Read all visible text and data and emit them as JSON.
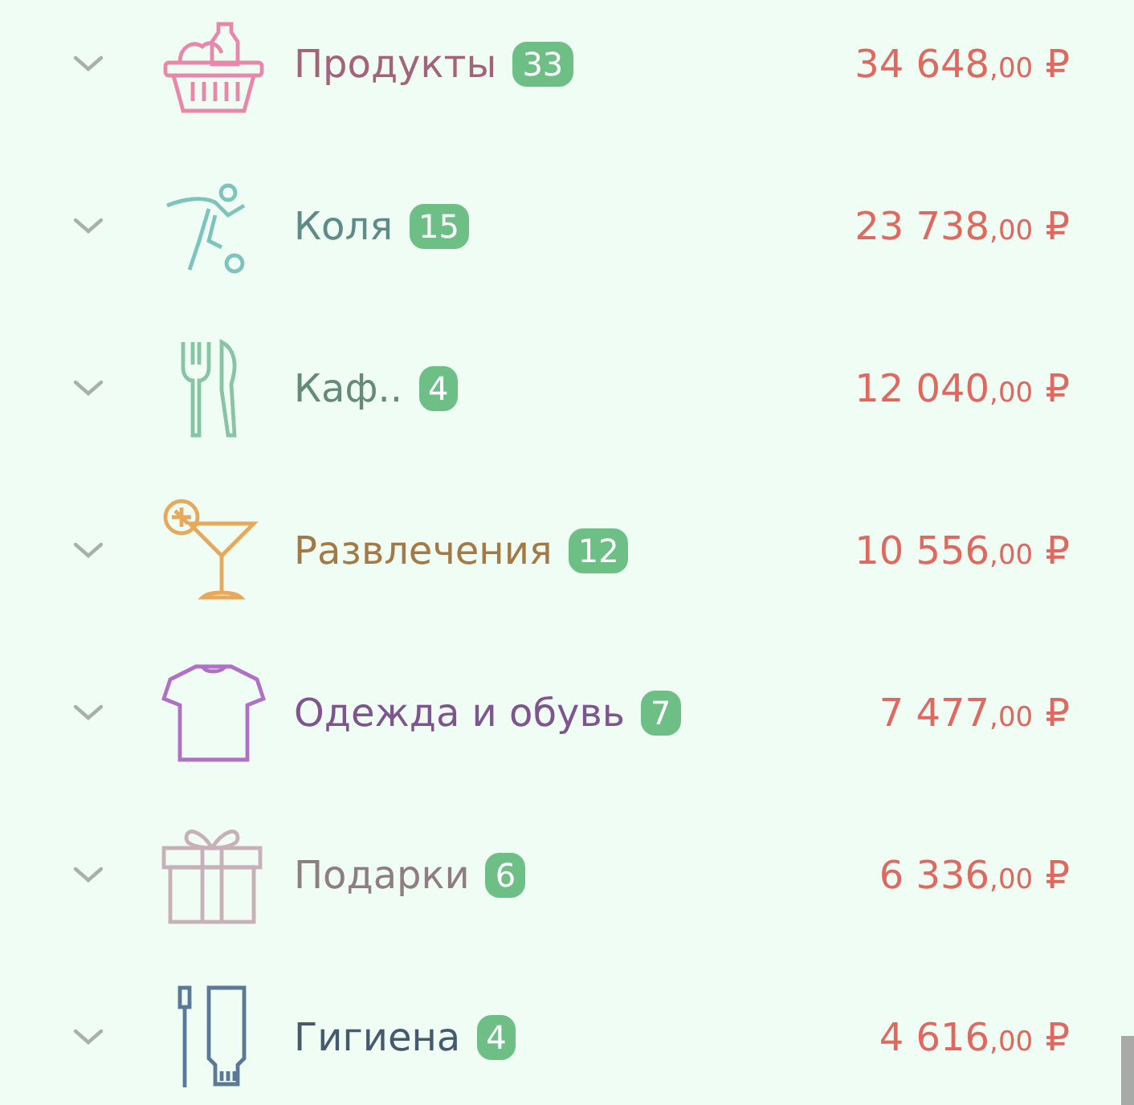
{
  "categories": [
    {
      "kind": "basket",
      "name": "Продукты",
      "count": "33",
      "color": "#e887a9",
      "amount": "34 648",
      "cents": ",00",
      "currency": "₽",
      "expanded": false
    },
    {
      "kind": "football",
      "name": "Коля",
      "count": "15",
      "color": "#7cc4bc",
      "amount": "23 738",
      "cents": ",00",
      "currency": "₽",
      "expanded": false
    },
    {
      "kind": "cutlery",
      "name": "Каф..",
      "count": "4",
      "color": "#88c4a4",
      "amount": "12 040",
      "cents": ",00",
      "currency": "₽",
      "expanded": false
    },
    {
      "kind": "cocktail",
      "name": "Развлечения",
      "count": "12",
      "color": "#e8a85a",
      "amount": "10 556",
      "cents": ",00",
      "currency": "₽",
      "expanded": false
    },
    {
      "kind": "shirt",
      "name": "Одежда и обувь",
      "count": "7",
      "color": "#b070c8",
      "amount": "7 477",
      "cents": ",00",
      "currency": "₽",
      "expanded": false
    },
    {
      "kind": "gift",
      "name": "Подарки",
      "count": "6",
      "color": "#c8b0b8",
      "amount": "6 336",
      "cents": ",00",
      "currency": "₽",
      "expanded": false
    },
    {
      "kind": "toothpaste",
      "name": "Гигиена",
      "count": "4",
      "color": "#5a7898",
      "amount": "4 616",
      "cents": ",00",
      "currency": "₽",
      "expanded": false
    }
  ]
}
